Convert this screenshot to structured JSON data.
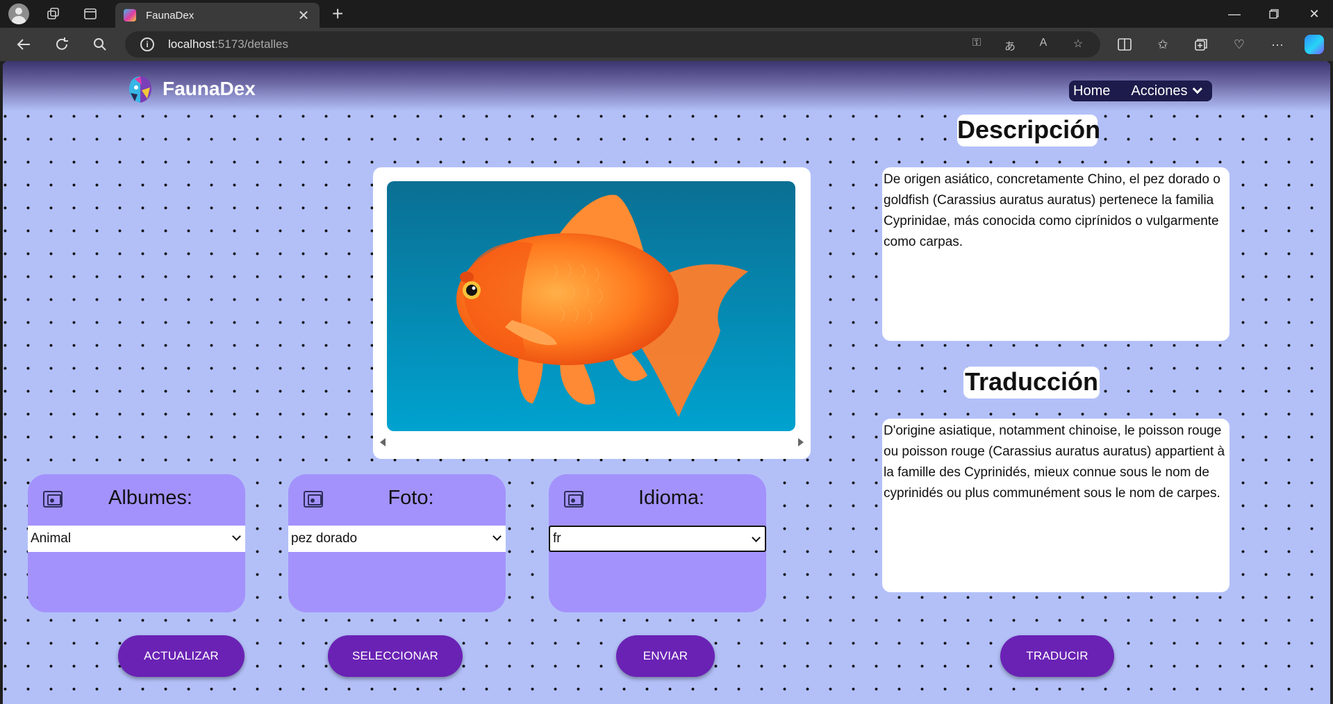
{
  "browser": {
    "tab_title": "FaunaDex",
    "url_host": "localhost",
    "url_path": ":5173/detalles"
  },
  "navbar": {
    "brand": "FaunaDex",
    "links": {
      "home": "Home",
      "acciones": "Acciones"
    }
  },
  "image": {
    "subject": "goldfish",
    "background_color": "#0b8fb8"
  },
  "panels": [
    {
      "title": "Albumes:",
      "selected": "Animal"
    },
    {
      "title": "Foto:",
      "selected": "pez dorado"
    },
    {
      "title": "Idioma:",
      "selected": "fr"
    }
  ],
  "buttons": {
    "actualizar": "ACTUALIZAR",
    "seleccionar": "SELECCIONAR",
    "enviar": "ENVIAR",
    "traducir": "TRADUCIR"
  },
  "descripcion": {
    "heading": "Descripción",
    "text": "De origen asiático, concretamente Chino, el pez dorado o goldfish (Carassius auratus auratus) pertenece la familia Cyprinidae, más conocida como ciprínidos o vulgarmente como carpas."
  },
  "traduccion": {
    "heading": "Traducción",
    "text": "D'origine asiatique, notamment chinoise, le poisson rouge ou poisson rouge (Carassius auratus auratus) appartient à la famille des Cyprinidés, mieux connue sous le nom de cyprinidés ou plus communément sous le nom de carpes."
  },
  "colors": {
    "page_bg": "#b3c0f8",
    "panel": "#a392fb",
    "button": "#6a22b4",
    "nav_pill": "#1d1b4b"
  }
}
